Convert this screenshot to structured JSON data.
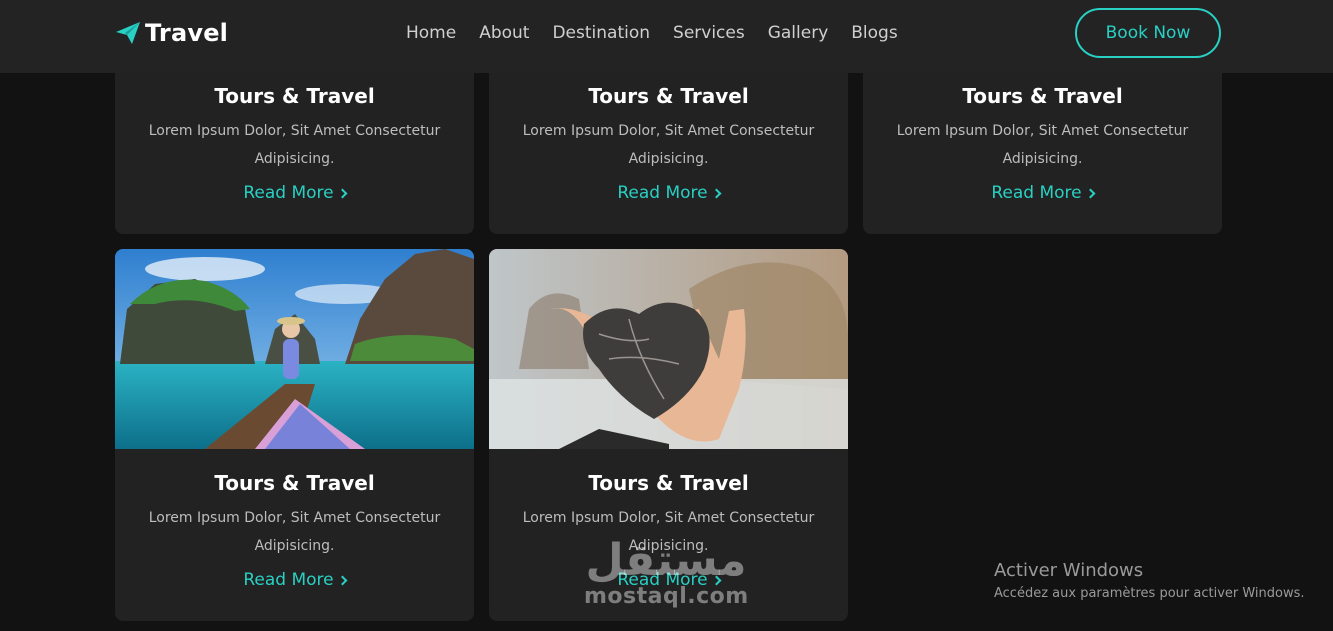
{
  "header": {
    "logo_text": "Travel",
    "nav": [
      "Home",
      "About",
      "Destination",
      "Services",
      "Gallery",
      "Blogs"
    ],
    "book_label": "Book Now",
    "accent_color": "#29d0c4"
  },
  "cards": [
    {
      "title": "Tours & Travel",
      "text": "Lorem Ipsum Dolor, Sit Amet Consectetur Adipisicing.",
      "link": "Read More"
    },
    {
      "title": "Tours & Travel",
      "text": "Lorem Ipsum Dolor, Sit Amet Consectetur Adipisicing.",
      "link": "Read More"
    },
    {
      "title": "Tours & Travel",
      "text": "Lorem Ipsum Dolor, Sit Amet Consectetur Adipisicing.",
      "link": "Read More"
    },
    {
      "title": "Tours & Travel",
      "text": "Lorem Ipsum Dolor, Sit Amet Consectetur Adipisicing.",
      "link": "Read More"
    },
    {
      "title": "Tours & Travel",
      "text": "Lorem Ipsum Dolor, Sit Amet Consectetur Adipisicing.",
      "link": "Read More"
    }
  ],
  "watermark": {
    "arabic": "مستقل",
    "latin": "mostaql.com"
  },
  "windows": {
    "title": "Activer Windows",
    "subtitle": "Accédez aux paramètres pour activer Windows."
  }
}
